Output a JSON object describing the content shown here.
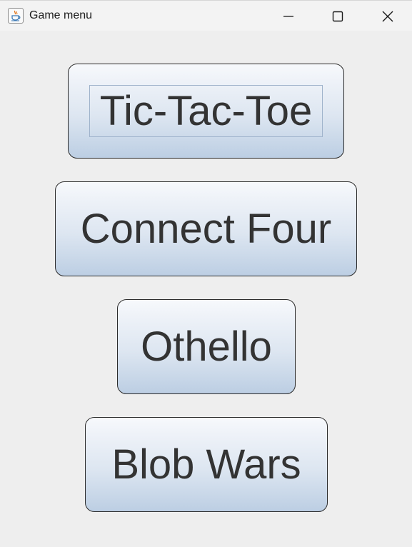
{
  "window": {
    "title": "Game menu",
    "app_icon": "java-coffee-cup-icon",
    "controls": {
      "minimize_icon": "minimize-icon",
      "maximize_icon": "maximize-icon",
      "close_icon": "close-icon"
    }
  },
  "menu": {
    "buttons": [
      {
        "label": "Tic-Tac-Toe",
        "focused": true
      },
      {
        "label": "Connect Four",
        "focused": false
      },
      {
        "label": "Othello",
        "focused": false
      },
      {
        "label": "Blob Wars",
        "focused": false
      }
    ]
  },
  "colors": {
    "background": "#eeeeee",
    "titlebar": "#f3f3f3",
    "button_text": "#333333",
    "button_border": "#2b2b2b",
    "button_gradient_top": "#f7f9fc",
    "button_gradient_bottom": "#bccee3",
    "focus_ring": "#9fb3cb"
  }
}
